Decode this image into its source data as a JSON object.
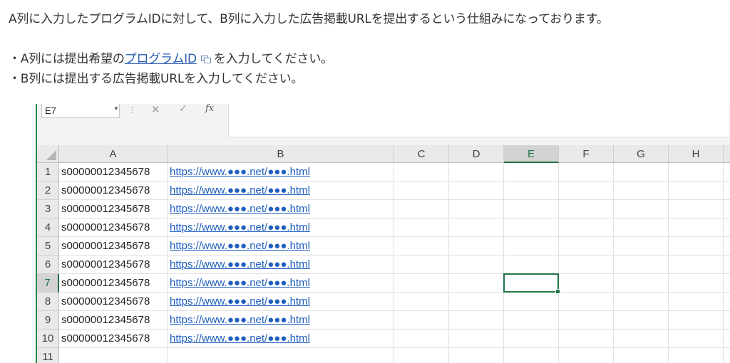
{
  "intro": "A列に入力したプログラムIDに対して、B列に入力した広告掲載URLを提出するという仕組みになっております。",
  "bullet1": {
    "prefix": "・A列には提出希望の",
    "link": "プログラムID",
    "suffix": "を入力してください。"
  },
  "bullet2": "・B列には提出する広告掲載URLを入力してください。",
  "spreadsheet": {
    "name_box": "E7",
    "formula_buttons": {
      "cancel": "✕",
      "enter": "✓",
      "function": "fx"
    },
    "columns": [
      "A",
      "B",
      "C",
      "D",
      "E",
      "F",
      "G",
      "H"
    ],
    "active_column": "E",
    "active_row": "7",
    "row_numbers": [
      "1",
      "2",
      "3",
      "4",
      "5",
      "6",
      "7",
      "8",
      "9",
      "10",
      "11"
    ],
    "rows": [
      {
        "a": "s00000012345678",
        "b": "https://www.●●●.net/●●●.html"
      },
      {
        "a": "s00000012345678",
        "b": "https://www.●●●.net/●●●.html"
      },
      {
        "a": "s00000012345678",
        "b": "https://www.●●●.net/●●●.html"
      },
      {
        "a": "s00000012345678",
        "b": "https://www.●●●.net/●●●.html"
      },
      {
        "a": "s00000012345678",
        "b": "https://www.●●●.net/●●●.html"
      },
      {
        "a": "s00000012345678",
        "b": "https://www.●●●.net/●●●.html"
      },
      {
        "a": "s00000012345678",
        "b": "https://www.●●●.net/●●●.html"
      },
      {
        "a": "s00000012345678",
        "b": "https://www.●●●.net/●●●.html"
      },
      {
        "a": "s00000012345678",
        "b": "https://www.●●●.net/●●●.html"
      },
      {
        "a": "s00000012345678",
        "b": "https://www.●●●.net/●●●.html"
      },
      {
        "a": "",
        "b": ""
      }
    ]
  },
  "colors": {
    "excel_green": "#217346",
    "link_blue": "#2a5db0",
    "url_blue": "#1f5fbf"
  }
}
